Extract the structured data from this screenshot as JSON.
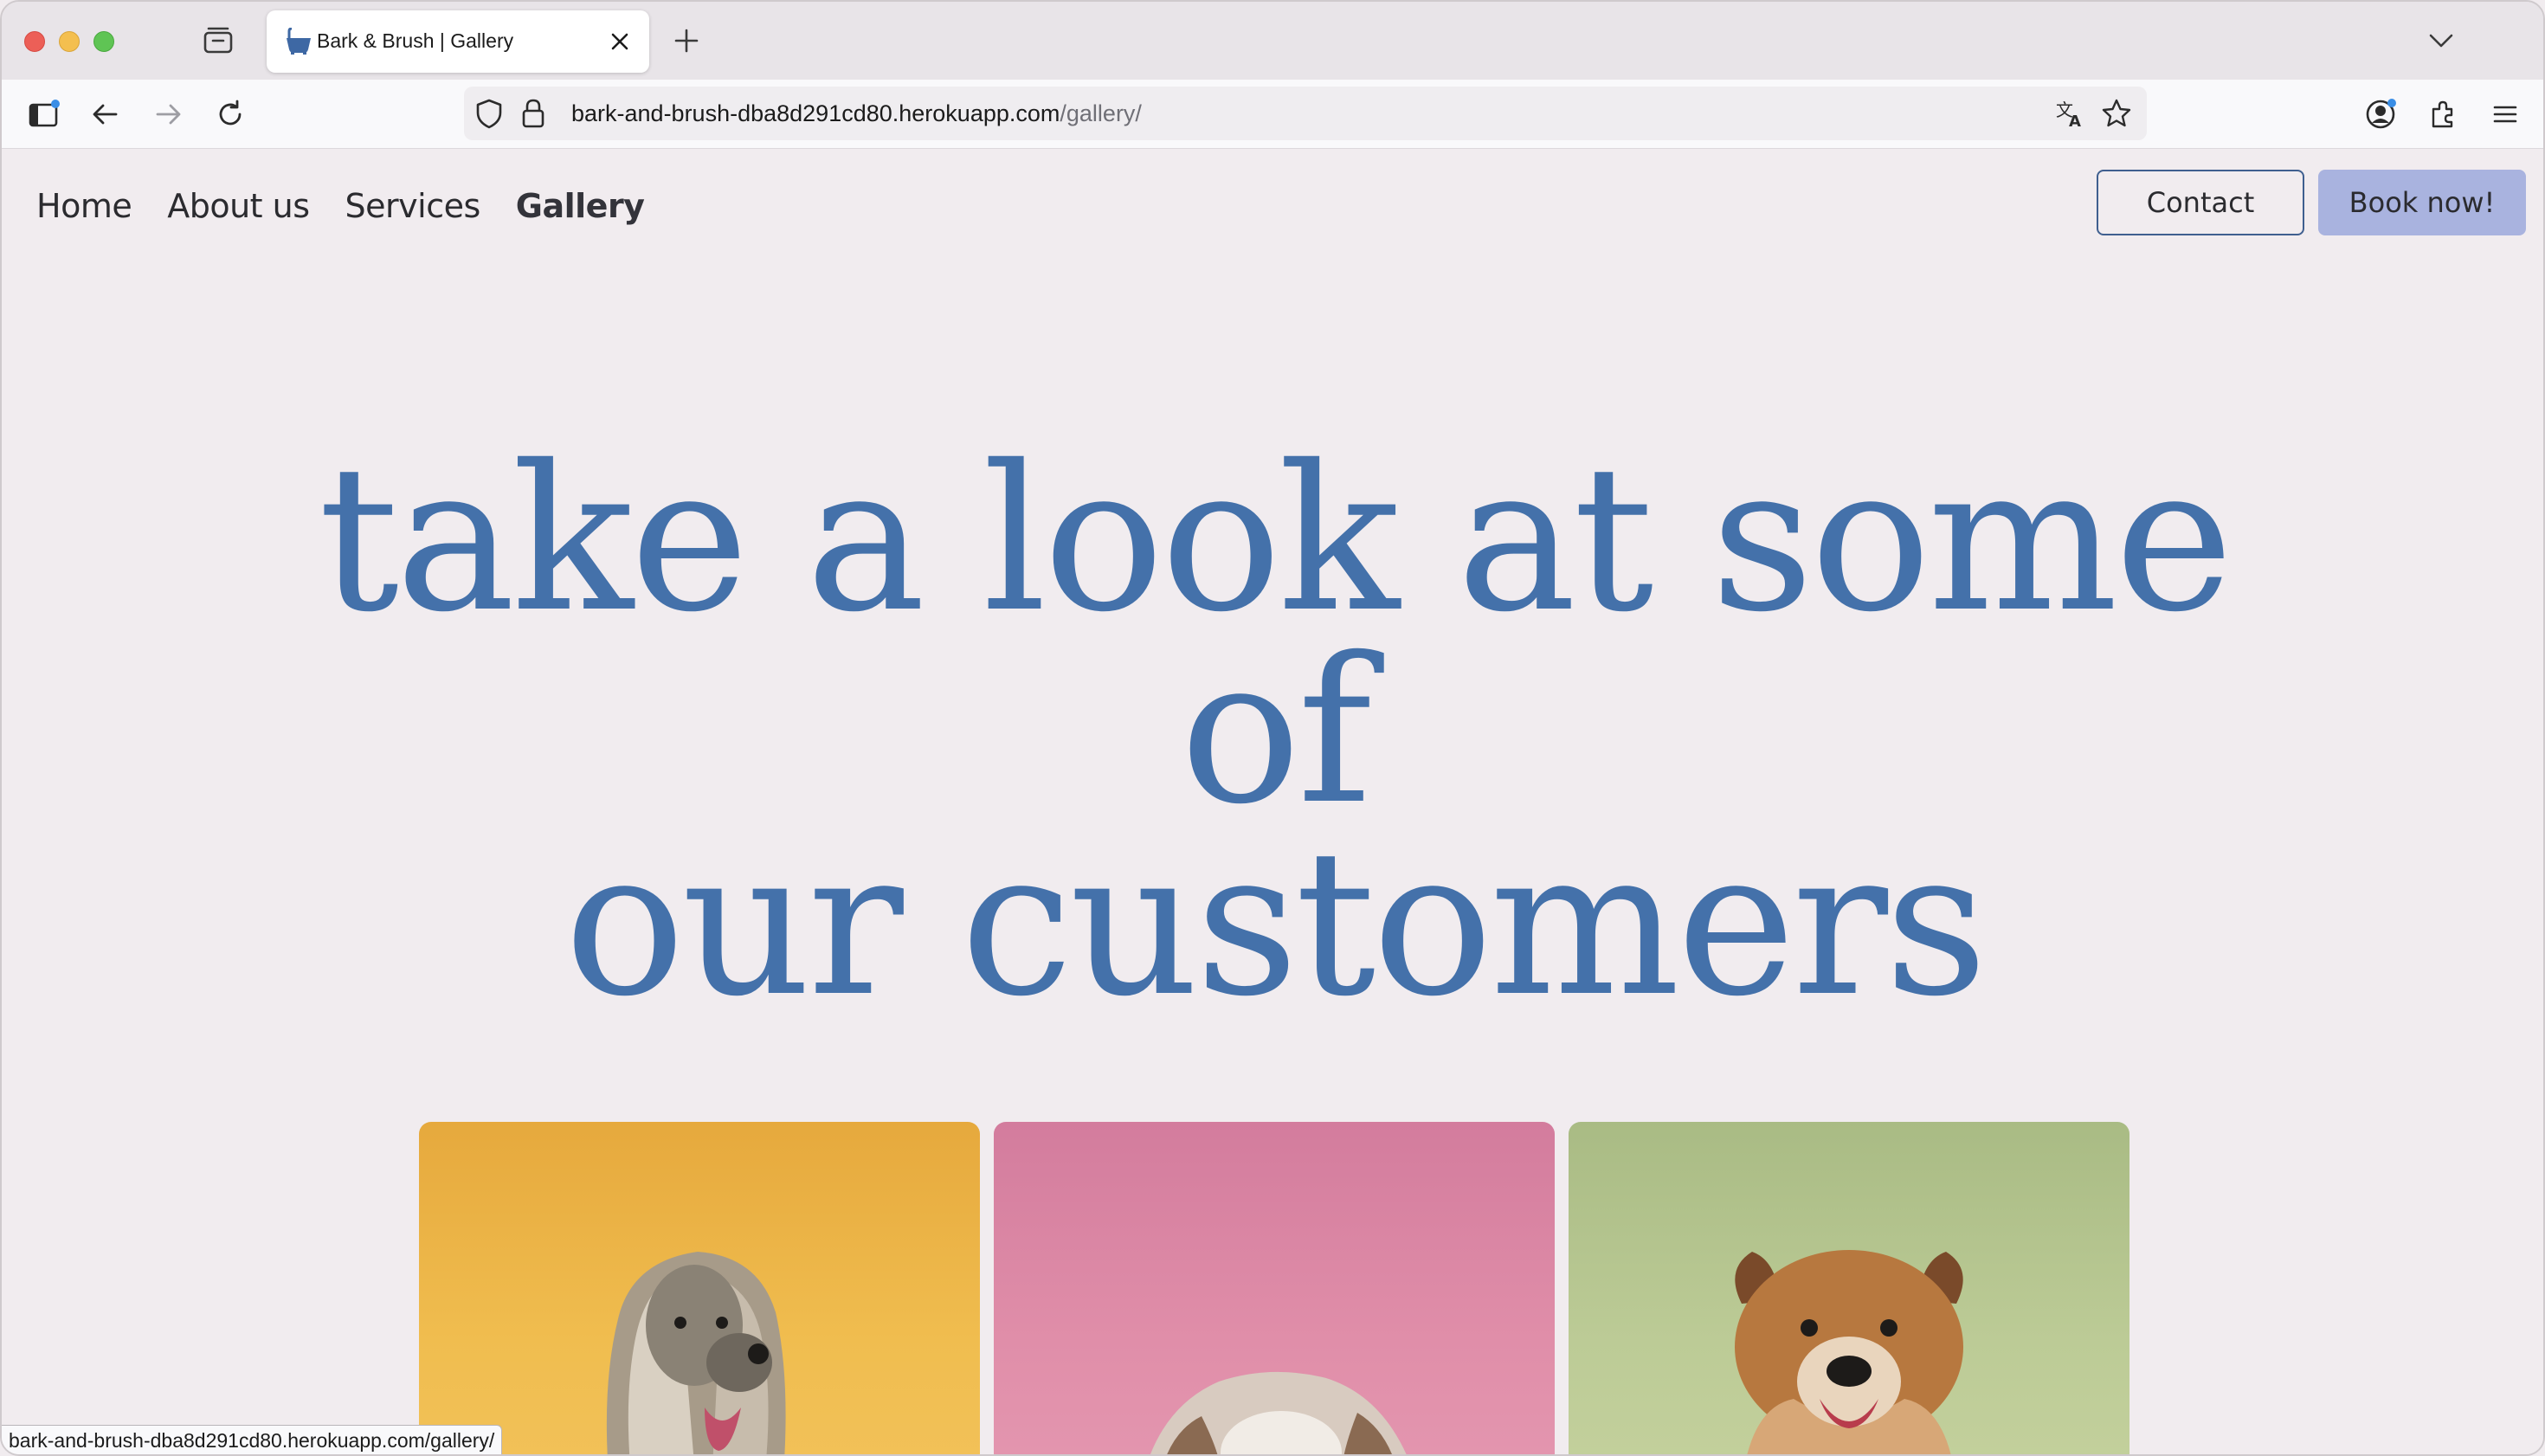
{
  "browser": {
    "tab_title": "Bark & Brush | Gallery",
    "url_host": "bark-and-brush-dba8d291cd80.herokuapp.com",
    "url_path": "/gallery/",
    "status_url": "bark-and-brush-dba8d291cd80.herokuapp.com/gallery/",
    "icons": [
      "tab-overview-icon",
      "close-icon",
      "plus-icon",
      "chevron-down-icon",
      "sidebar-icon",
      "back-arrow-icon",
      "forward-arrow-icon",
      "reload-icon",
      "shield-icon",
      "lock-icon",
      "translate-icon",
      "star-icon",
      "account-icon",
      "extensions-icon",
      "menu-icon"
    ]
  },
  "site": {
    "nav": {
      "home": "Home",
      "about": "About us",
      "services": "Services",
      "gallery": "Gallery"
    },
    "contact_label": "Contact",
    "book_label": "Book now!",
    "hero_line1": "take a look at some of",
    "hero_line2": "our customers",
    "colors": {
      "accent_blue": "#4471aa",
      "book_button": "#a9b3df",
      "page_bg": "#f1ecef",
      "card_yellow": "#f0bd4f",
      "card_pink": "#e08ea9",
      "card_green": "#bccb96"
    }
  }
}
